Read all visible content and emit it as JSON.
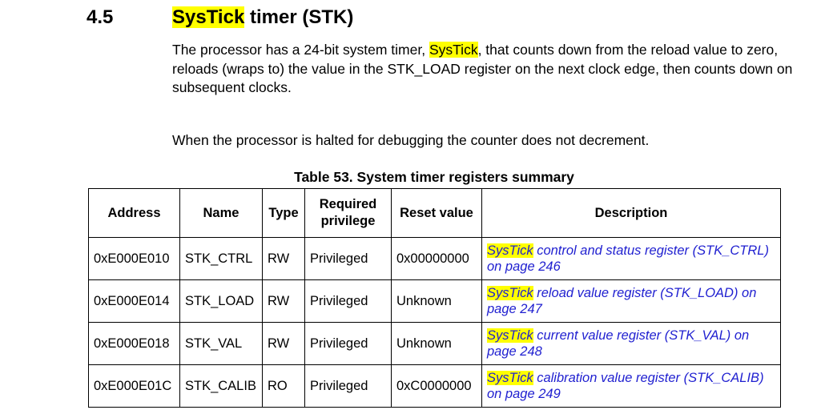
{
  "section": {
    "number": "4.5",
    "title_highlight": "SysTick",
    "title_rest": " timer (STK)"
  },
  "paragraph1": {
    "before": "The processor has a 24-bit system timer, ",
    "highlight": "SysTick",
    "after": ", that counts down from the reload value to zero, reloads (wraps to) the value in the STK_LOAD register on the next clock edge, then counts down on subsequent clocks."
  },
  "paragraph2": "When the processor is halted for debugging the counter does not decrement.",
  "table": {
    "caption": "Table 53. System timer registers summary",
    "headers": {
      "address": "Address",
      "name": "Name",
      "type": "Type",
      "privilege": "Required privilege",
      "reset": "Reset value",
      "description": "Description"
    },
    "rows": [
      {
        "address": "0xE000E010",
        "name": "STK_CTRL",
        "type": "RW",
        "privilege": "Privileged",
        "reset": "0x00000000",
        "desc_highlight": "SysTick",
        "desc_rest": " control and status register (STK_CTRL) on page 246"
      },
      {
        "address": "0xE000E014",
        "name": "STK_LOAD",
        "type": "RW",
        "privilege": "Privileged",
        "reset": "Unknown",
        "desc_highlight": "SysTick",
        "desc_rest": " reload value register (STK_LOAD) on page 247"
      },
      {
        "address": "0xE000E018",
        "name": "STK_VAL",
        "type": "RW",
        "privilege": "Privileged",
        "reset": "Unknown",
        "desc_highlight": "SysTick",
        "desc_rest": " current value register (STK_VAL) on page 248"
      },
      {
        "address": "0xE000E01C",
        "name": "STK_CALIB",
        "type": "RO",
        "privilege": "Privileged",
        "reset": "0xC0000000",
        "desc_highlight": "SysTick",
        "desc_rest": " calibration value register (STK_CALIB) on page 249"
      }
    ]
  },
  "colors": {
    "highlight": "#ffff00",
    "link": "#1f1fd0"
  }
}
